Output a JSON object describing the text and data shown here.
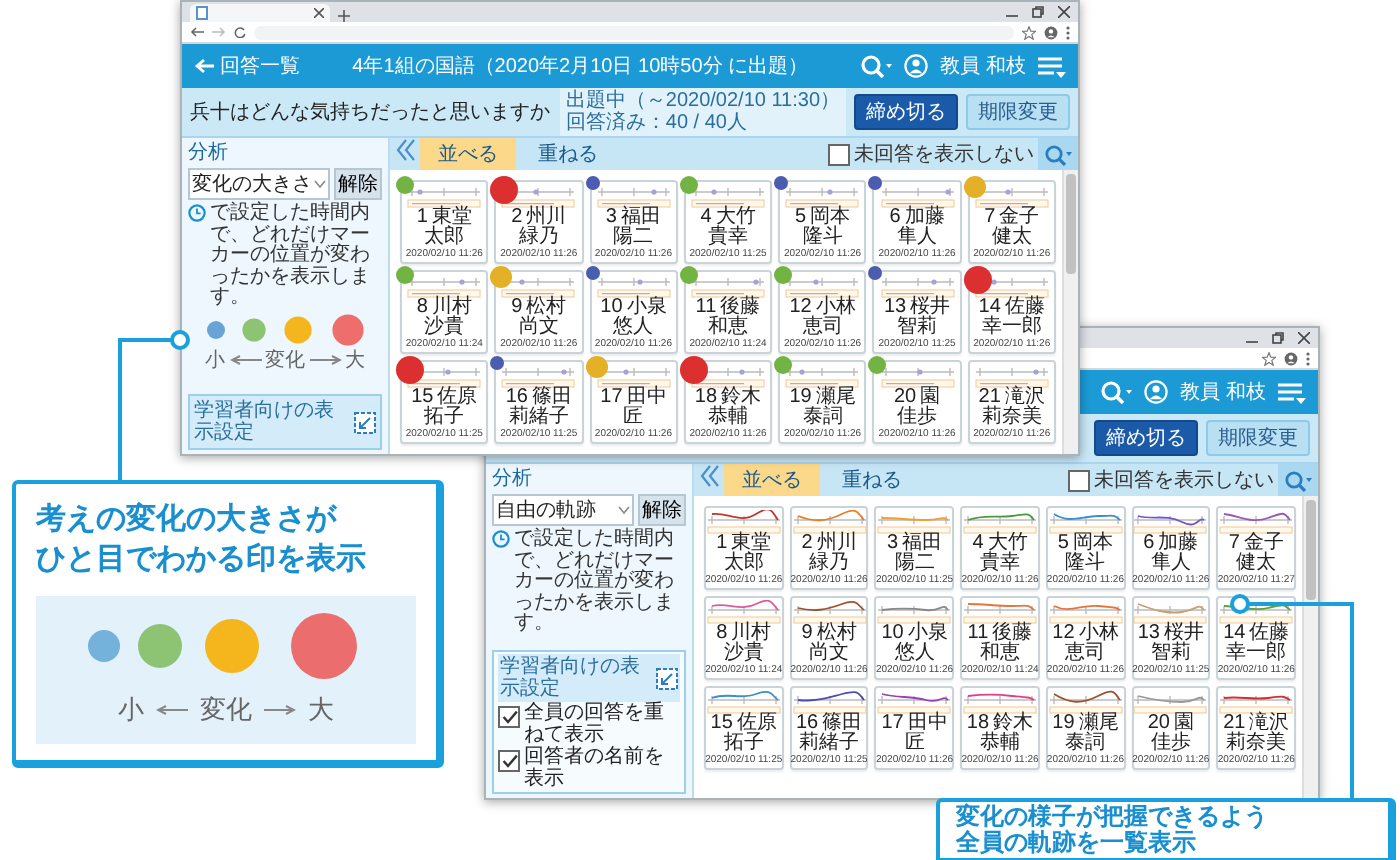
{
  "top_window": {
    "back_link": "回答一覧",
    "title": "4年1組の国語（2020年2月10日 10時50分 に出題）",
    "user": "教員 和枝",
    "question": "兵十はどんな気持ちだったと思いますか",
    "status": "出題中（～2020/02/10 11:30）",
    "answered": "回答済み：40 / 40人",
    "buttons": [
      "締め切る",
      "期限変更"
    ],
    "analysis_label": "分析",
    "analysis_select": "変化の大きさ",
    "clear_button": "解除",
    "analysis_note": "で設定した時間内で、どれだけマーカーの位置が変わったかを表示します。",
    "legend": {
      "small": "小",
      "label": "変化",
      "large": "大"
    },
    "learner_settings": "学習者向けの表示設定",
    "view_tabs": [
      {
        "label": "並べる",
        "selected": true
      },
      {
        "label": "重ねる",
        "selected": false
      }
    ],
    "hide_unanswered": {
      "label": "未回答を表示しない",
      "checked": false
    },
    "cards": [
      {
        "number": "1",
        "surname": "東堂",
        "given_name": "太郎",
        "time": "2020/02/10 11:26",
        "marker": {
          "kind": "medium",
          "color": "#72b443"
        }
      },
      {
        "number": "2",
        "surname": "州川",
        "given_name": "緑乃",
        "time": "2020/02/10 11:26",
        "marker": {
          "kind": "max",
          "color": "#dc2f2f"
        }
      },
      {
        "number": "3",
        "surname": "福田",
        "given_name": "陽二",
        "time": "2020/02/10 11:26",
        "marker": {
          "kind": "small",
          "color": "#4a5db0"
        }
      },
      {
        "number": "4",
        "surname": "大竹",
        "given_name": "貴幸",
        "time": "2020/02/10 11:25",
        "marker": {
          "kind": "medium",
          "color": "#72b443"
        }
      },
      {
        "number": "5",
        "surname": "岡本",
        "given_name": "隆斗",
        "time": "2020/02/10 11:26",
        "marker": {
          "kind": "small",
          "color": "#4a5db0"
        }
      },
      {
        "number": "6",
        "surname": "加藤",
        "given_name": "隼人",
        "time": "2020/02/10 11:26",
        "marker": {
          "kind": "small",
          "color": "#4a5db0"
        }
      },
      {
        "number": "7",
        "surname": "金子",
        "given_name": "健太",
        "time": "2020/02/10 11:26",
        "marker": {
          "kind": "large",
          "color": "#e3b027"
        }
      },
      {
        "number": "8",
        "surname": "川村",
        "given_name": "沙貴",
        "time": "2020/02/10 11:24",
        "marker": {
          "kind": "medium",
          "color": "#72b443"
        }
      },
      {
        "number": "9",
        "surname": "松村",
        "given_name": "尚文",
        "time": "2020/02/10 11:26",
        "marker": {
          "kind": "large",
          "color": "#e3b027"
        }
      },
      {
        "number": "10",
        "surname": "小泉",
        "given_name": "悠人",
        "time": "2020/02/10 11:26",
        "marker": {
          "kind": "small",
          "color": "#4a5db0"
        }
      },
      {
        "number": "11",
        "surname": "後藤",
        "given_name": "和恵",
        "time": "2020/02/10 11:24",
        "marker": {
          "kind": "medium",
          "color": "#72b443"
        }
      },
      {
        "number": "12",
        "surname": "小林",
        "given_name": "恵司",
        "time": "2020/02/10 11:26",
        "marker": {
          "kind": "medium",
          "color": "#72b443"
        }
      },
      {
        "number": "13",
        "surname": "桜井",
        "given_name": "智莉",
        "time": "2020/02/10 11:25",
        "marker": {
          "kind": "small",
          "color": "#4a5db0"
        }
      },
      {
        "number": "14",
        "surname": "佐藤",
        "given_name": "幸一郎",
        "time": "2020/02/10 11:26",
        "marker": {
          "kind": "max",
          "color": "#dc2f2f"
        }
      },
      {
        "number": "15",
        "surname": "佐原",
        "given_name": "拓子",
        "time": "2020/02/10 11:25",
        "marker": {
          "kind": "max",
          "color": "#dc2f2f"
        }
      },
      {
        "number": "16",
        "surname": "篠田",
        "given_name": "莉緒子",
        "time": "2020/02/10 11:25",
        "marker": {
          "kind": "small",
          "color": "#4a5db0"
        }
      },
      {
        "number": "17",
        "surname": "田中",
        "given_name": "匠",
        "time": "2020/02/10 11:26",
        "marker": {
          "kind": "large",
          "color": "#e3b027"
        }
      },
      {
        "number": "18",
        "surname": "鈴木",
        "given_name": "恭輔",
        "time": "2020/02/10 11:26",
        "marker": {
          "kind": "max",
          "color": "#dc2f2f"
        }
      },
      {
        "number": "19",
        "surname": "瀬尾",
        "given_name": "泰詞",
        "time": "2020/02/10 11:26",
        "marker": {
          "kind": "medium",
          "color": "#72b443"
        }
      },
      {
        "number": "20",
        "surname": "園",
        "given_name": "佳歩",
        "time": "2020/02/10 11:26",
        "marker": {
          "kind": "medium",
          "color": "#72b443"
        }
      },
      {
        "number": "21",
        "surname": "滝沢",
        "given_name": "莉奈美",
        "time": "2020/02/10 11:26"
      }
    ]
  },
  "bottom_window": {
    "user": "教員 和枝",
    "buttons": [
      "締め切る",
      "期限変更"
    ],
    "analysis_label": "分析",
    "analysis_select": "自由の軌跡",
    "clear_button": "解除",
    "analysis_note": "で設定した時間内で、どれだけマーカーの位置が変わったかを表示します。",
    "learner_settings": {
      "title": "学習者向けの表示設定",
      "options": [
        {
          "label": "全員の回答を重ねて表示",
          "checked": true
        },
        {
          "label": "回答者の名前を表示",
          "checked": true
        }
      ]
    },
    "view_tabs": [
      {
        "label": "並べる",
        "selected": true
      },
      {
        "label": "重ねる",
        "selected": false
      }
    ],
    "hide_unanswered": {
      "label": "未回答を表示しない",
      "checked": false
    },
    "cards": [
      {
        "number": "1",
        "surname": "東堂",
        "given_name": "太郎",
        "time": "2020/02/10 11:26",
        "color": "#c0392b"
      },
      {
        "number": "2",
        "surname": "州川",
        "given_name": "緑乃",
        "time": "2020/02/10 11:26",
        "color": "#e67e22"
      },
      {
        "number": "3",
        "surname": "福田",
        "given_name": "陽二",
        "time": "2020/02/10 11:25",
        "color": "#f0a030"
      },
      {
        "number": "4",
        "surname": "大竹",
        "given_name": "貴幸",
        "time": "2020/02/10 11:26",
        "color": "#4a9a3a"
      },
      {
        "number": "5",
        "surname": "岡本",
        "given_name": "隆斗",
        "time": "2020/02/10 11:26",
        "color": "#3a8fd0"
      },
      {
        "number": "6",
        "surname": "加藤",
        "given_name": "隼人",
        "time": "2020/02/10 11:26",
        "color": "#6a5acd"
      },
      {
        "number": "7",
        "surname": "金子",
        "given_name": "健太",
        "time": "2020/02/10 11:27",
        "color": "#9b59b6"
      },
      {
        "number": "8",
        "surname": "川村",
        "given_name": "沙貴",
        "time": "2020/02/10 11:24",
        "color": "#e05a9a"
      },
      {
        "number": "9",
        "surname": "松村",
        "given_name": "尚文",
        "time": "2020/02/10 11:26",
        "color": "#a0522d"
      },
      {
        "number": "10",
        "surname": "小泉",
        "given_name": "悠人",
        "time": "2020/02/10 11:26",
        "color": "#888888"
      },
      {
        "number": "11",
        "surname": "後藤",
        "given_name": "和恵",
        "time": "2020/02/10 11:24",
        "color": "#e8743b"
      },
      {
        "number": "12",
        "surname": "小林",
        "given_name": "恵司",
        "time": "2020/02/10 11:26",
        "color": "#e8743b"
      },
      {
        "number": "13",
        "surname": "桜井",
        "given_name": "智莉",
        "time": "2020/02/10 11:25",
        "color": "#c8a070"
      },
      {
        "number": "14",
        "surname": "佐藤",
        "given_name": "幸一郎",
        "time": "2020/02/10 11:26",
        "color": "#5aa040"
      },
      {
        "number": "15",
        "surname": "佐原",
        "given_name": "拓子",
        "time": "2020/02/10 11:25",
        "color": "#3a8fd0"
      },
      {
        "number": "16",
        "surname": "篠田",
        "given_name": "莉緒子",
        "time": "2020/02/10 11:25",
        "color": "#4b4bb0"
      },
      {
        "number": "17",
        "surname": "田中",
        "given_name": "匠",
        "time": "2020/02/10 11:26",
        "color": "#9b3fb5"
      },
      {
        "number": "18",
        "surname": "鈴木",
        "given_name": "恭輔",
        "time": "2020/02/10 11:26",
        "color": "#e0408a"
      },
      {
        "number": "19",
        "surname": "瀬尾",
        "given_name": "泰詞",
        "time": "2020/02/10 11:26",
        "color": "#a0522d"
      },
      {
        "number": "20",
        "surname": "園",
        "given_name": "佳歩",
        "time": "2020/02/10 11:26",
        "color": "#999999"
      },
      {
        "number": "21",
        "surname": "滝沢",
        "given_name": "莉奈美",
        "time": "2020/02/10 11:26",
        "color": "#d03030"
      }
    ]
  },
  "callouts": [
    {
      "kind": "legend",
      "title_lines": [
        "考えの変化の大きさが",
        "ひと目でわかる印を表示"
      ],
      "legend": {
        "small": "小",
        "label": "変化",
        "large": "大"
      }
    },
    {
      "kind": "plain",
      "title_lines": [
        "変化の様子が把握できるよう",
        "全員の軌跡を一覧表示"
      ]
    }
  ]
}
